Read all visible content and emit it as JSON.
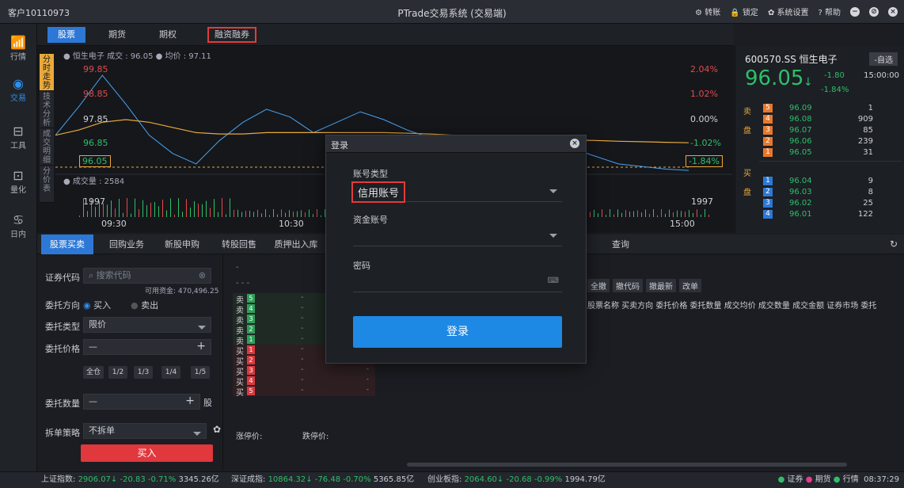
{
  "titlebar": {
    "account": "客户10110973",
    "title": "PTrade交易系统 (交易端)",
    "actions": [
      "转账",
      "锁定",
      "系统设置",
      "帮助"
    ]
  },
  "leftnav": {
    "items": [
      "行情",
      "交易",
      "工具",
      "量化",
      "日内"
    ]
  },
  "toptabs": [
    "股票",
    "期货",
    "期权",
    "融资融券"
  ],
  "chart": {
    "side_tabs": [
      "分时走势",
      "技术分析",
      "成交明细",
      "分价表"
    ],
    "legend": "● 恒生电子  成交 : 96.05  ● 均价 : 97.11",
    "volume_label": "● 成交量 : 2584",
    "price_ticks": [
      "99.85",
      "98.85",
      "97.85",
      "96.85",
      "96.05"
    ],
    "pct_ticks": [
      "2.04%",
      "1.02%",
      "0.00%",
      "-1.02%",
      "-1.84%"
    ],
    "vol_left": "1997",
    "vol_right": "1997",
    "time_ticks": [
      "09:30",
      "10:30",
      "15:00"
    ]
  },
  "chart_data": {
    "type": "line",
    "title": "",
    "series": [
      {
        "name": "恒生电子",
        "values": [
          97.4,
          98.5,
          99.7,
          98.6,
          97.4,
          96.7,
          96.3,
          97.2,
          97.9,
          98.4,
          98.1,
          97.5,
          97.9,
          98.3,
          98.0,
          97.6,
          97.3,
          97.0,
          96.8,
          96.6,
          96.4,
          96.7,
          96.9,
          96.6,
          96.3,
          96.2,
          96.1,
          96.05
        ]
      },
      {
        "name": "均价",
        "values": [
          97.4,
          97.6,
          97.9,
          98.0,
          97.9,
          97.7,
          97.5,
          97.45,
          97.45,
          97.5,
          97.5,
          97.5,
          97.5,
          97.5,
          97.5,
          97.48,
          97.45,
          97.4,
          97.35,
          97.3,
          97.27,
          97.25,
          97.22,
          97.2,
          97.17,
          97.15,
          97.13,
          97.11
        ]
      }
    ],
    "ylim": [
      95.9,
      100.1
    ]
  },
  "quote": {
    "code": "600570.SS 恒生电子",
    "fav": "-自选",
    "price": "96.05",
    "arrow": "↓",
    "change": "-1.80",
    "pct": "-1.84%",
    "time": "15:00:00",
    "sell_label": "卖盘",
    "buy_label": "买盘",
    "asks": [
      {
        "n": "5",
        "p": "96.09",
        "v": "1"
      },
      {
        "n": "4",
        "p": "96.08",
        "v": "909"
      },
      {
        "n": "3",
        "p": "96.07",
        "v": "85"
      },
      {
        "n": "2",
        "p": "96.06",
        "v": "239"
      },
      {
        "n": "1",
        "p": "96.05",
        "v": "31"
      }
    ],
    "bids": [
      {
        "n": "1",
        "p": "96.04",
        "v": "9"
      },
      {
        "n": "2",
        "p": "96.03",
        "v": "8"
      },
      {
        "n": "3",
        "p": "96.02",
        "v": "25"
      },
      {
        "n": "4",
        "p": "96.01",
        "v": "122"
      }
    ]
  },
  "bottomtabs": [
    "股票买卖",
    "回购业务",
    "新股申购",
    "转股回售",
    "质押出入库",
    "查询"
  ],
  "form": {
    "code_label": "证券代码",
    "search_placeholder": "搜索代码",
    "available": "可用资金: 470,496.25",
    "direction_label": "委托方向",
    "buy": "买入",
    "sell": "卖出",
    "type_label": "委托类型",
    "type_value": "限价",
    "price_label": "委托价格",
    "fractions": [
      "全仓",
      "1/2",
      "1/3",
      "1/4",
      "1/5"
    ],
    "qty_label": "委托数量",
    "qty_unit": "股",
    "split_label": "拆单策略",
    "split_value": "不拆单",
    "submit": "买入"
  },
  "book": {
    "dashes": "- - -",
    "dash": "-",
    "sell": [
      "卖",
      "卖",
      "卖",
      "卖",
      "卖"
    ],
    "sellnums": [
      "5",
      "4",
      "3",
      "2",
      "1"
    ],
    "buy": [
      "买",
      "买",
      "买",
      "买",
      "买"
    ],
    "buynums": [
      "1",
      "2",
      "3",
      "4",
      "5"
    ],
    "limit_up": "涨停价:",
    "limit_down": "跌停价:"
  },
  "orders": {
    "buttons": [
      "全撤",
      "撤代码",
      "撤最新",
      "改单"
    ],
    "columns": "股票名称 买卖方向 委托价格 委托数量 成交均价 成交数量 成交金额 证券市场 委托"
  },
  "modal": {
    "title": "登录",
    "account_type_label": "账号类型",
    "account_type_value": "信用账号",
    "fund_label": "资金账号",
    "password_label": "密码",
    "submit": "登录"
  },
  "status": {
    "sh_label": "上证指数:",
    "sh": "2906.07↓ -20.83  -0.71%",
    "sh_amt": "3345.26亿",
    "sz_label": "深证成指:",
    "sz": "10864.32↓ -76.48  -0.70%",
    "sz_amt": "5365.85亿",
    "cy_label": "创业板指:",
    "cy": "2064.60↓ -20.68  -0.99%",
    "cy_amt": "1994.79亿",
    "right": [
      "证券",
      "期货",
      "行情"
    ],
    "time": "08:37:29"
  }
}
